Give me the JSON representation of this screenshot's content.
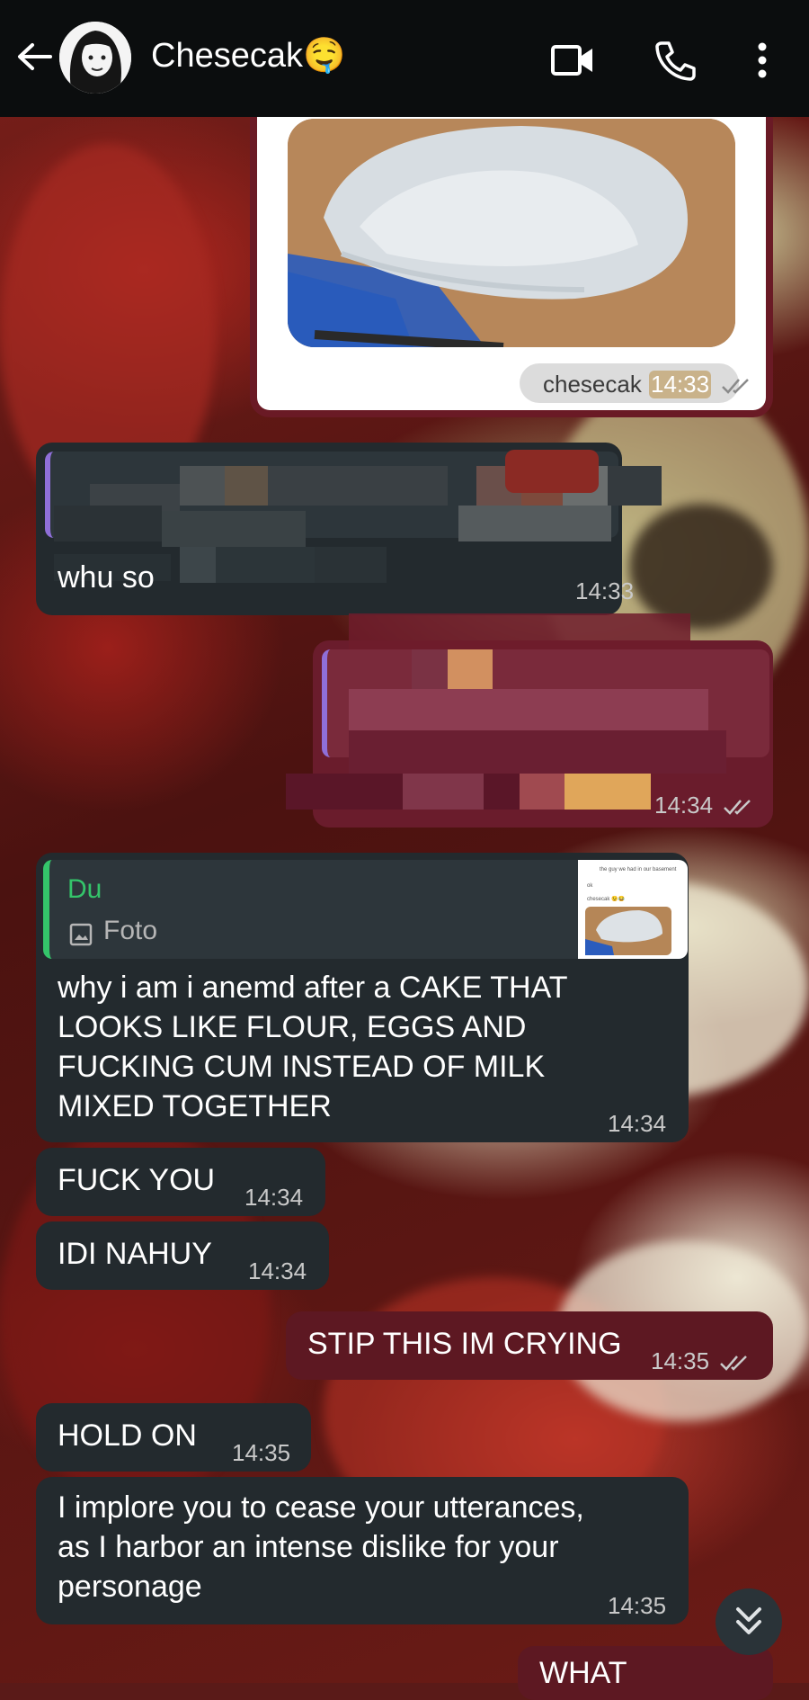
{
  "header": {
    "contact_name": "Chesecak",
    "contact_emoji": "🤤",
    "icons": [
      "back-arrow-icon",
      "video-call-icon",
      "voice-call-icon",
      "more-vert-icon"
    ]
  },
  "messages": {
    "m1": {
      "caption": "chesecak",
      "time": "14:33"
    },
    "m2": {
      "visible_text": "whu so",
      "time": "14:33"
    },
    "m3": {
      "time": "14:34"
    },
    "m4": {
      "reply_author": "Du",
      "reply_media": "Foto",
      "reply_thumb_lines": [
        "the guy we had in our basement",
        "ok",
        "chesecak 😉😂"
      ],
      "text": "why i am i anemd after a CAKE THAT\nLOOKS LIKE FLOUR, EGGS AND\nFUCKING CUM INSTEAD OF MILK\nMIXED TOGETHER",
      "time": "14:34"
    },
    "m5": {
      "text": "FUCK YOU",
      "time": "14:34"
    },
    "m6": {
      "text": "IDI NAHUY",
      "time": "14:34"
    },
    "m7": {
      "text": "STIP THIS IM CRYING",
      "time": "14:35"
    },
    "m8": {
      "text": "HOLD ON",
      "time": "14:35"
    },
    "m9": {
      "text": "I implore you to cease your utterances,\nas I harbor an intense dislike for your\npersonage",
      "time": "14:35"
    },
    "m10": {
      "text": "WHAT"
    }
  },
  "colors": {
    "incoming_bubble": "#232a2e",
    "outgoing_bubble": "#5d1822",
    "reply_accent_green": "#34c46a",
    "reply_accent_purple": "#8f6fd8",
    "topbar": "#0b0d0e"
  },
  "scroll_down_icon": "double-chevron-down-icon"
}
